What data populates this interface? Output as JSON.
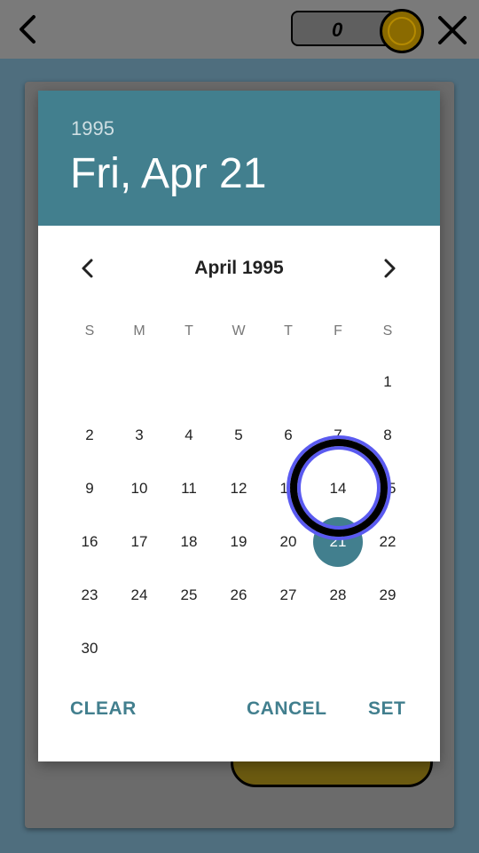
{
  "topbar": {
    "coin_count": "0",
    "icons": {
      "back": "chevron-left-icon",
      "close": "close-icon",
      "coin": "coin-icon"
    }
  },
  "colors": {
    "accent": "#427f8e",
    "background": "#4f6e7e",
    "touch_indicator": "#5a5af0"
  },
  "dialog": {
    "header": {
      "year": "1995",
      "date": "Fri, Apr 21"
    },
    "month_label": "April 1995",
    "weekdays": [
      "S",
      "M",
      "T",
      "W",
      "T",
      "F",
      "S"
    ],
    "weeks": [
      [
        "",
        "",
        "",
        "",
        "",
        "",
        "1"
      ],
      [
        "2",
        "3",
        "4",
        "5",
        "6",
        "7",
        "8"
      ],
      [
        "9",
        "10",
        "11",
        "12",
        "13",
        "14",
        "15"
      ],
      [
        "16",
        "17",
        "18",
        "19",
        "20",
        "21",
        "22"
      ],
      [
        "23",
        "24",
        "25",
        "26",
        "27",
        "28",
        "29"
      ],
      [
        "30",
        "",
        "",
        "",
        "",
        "",
        ""
      ]
    ],
    "selected_day": "21",
    "buttons": {
      "clear": "CLEAR",
      "cancel": "CANCEL",
      "set": "SET"
    }
  }
}
